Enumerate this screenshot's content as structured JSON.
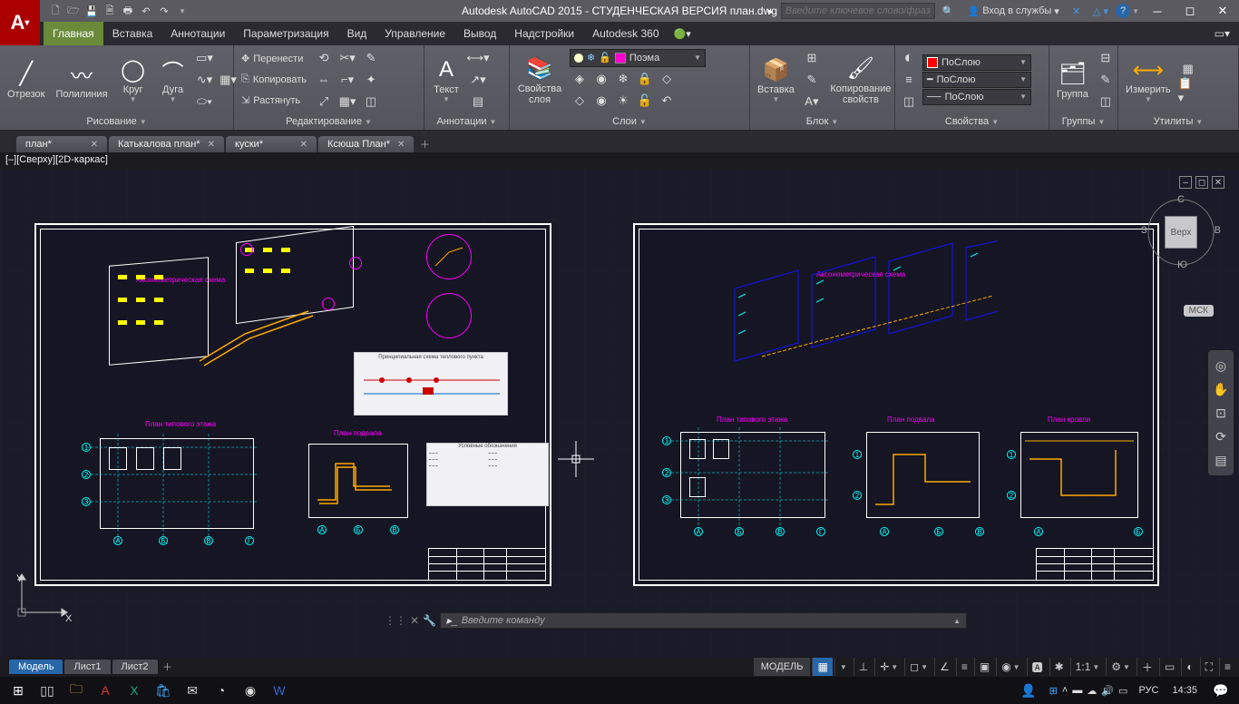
{
  "title": "Autodesk AutoCAD 2015 - СТУДЕНЧЕСКАЯ ВЕРСИЯ   план.dwg",
  "search_placeholder": "Введите ключевое слово/фразу",
  "sign_in": "Вход в службы",
  "ribbon_tabs": [
    "Главная",
    "Вставка",
    "Аннотации",
    "Параметризация",
    "Вид",
    "Управление",
    "Вывод",
    "Надстройки",
    "Autodesk 360"
  ],
  "panels": {
    "draw": {
      "label": "Рисование",
      "line": "Отрезок",
      "polyline": "Полилиния",
      "circle": "Круг",
      "arc": "Дуга"
    },
    "modify": {
      "label": "Редактирование",
      "move": "Перенести",
      "copy": "Копировать",
      "stretch": "Растянуть"
    },
    "annotation": {
      "label": "Аннотации",
      "text": "Текст"
    },
    "layers": {
      "label": "Слои",
      "props": "Свойства слоя",
      "current": "Поэма"
    },
    "block": {
      "label": "Блок",
      "insert": "Вставка",
      "copy_props": "Копирование свойств"
    },
    "properties": {
      "label": "Свойства",
      "bylayer": "ПоСлою",
      "byblock": "ПоСлою",
      "line3": "ПоСлою"
    },
    "groups": {
      "label": "Группы",
      "group": "Группа"
    },
    "utilities": {
      "label": "Утилиты",
      "measure": "Измерить"
    }
  },
  "file_tabs": [
    "план*",
    "Катькалова план*",
    "куски*",
    "Ксюша План*"
  ],
  "viewport_label": "[–][Сверху][2D-каркас]",
  "navcube": {
    "top": "Верх",
    "n": "С",
    "s": "Ю",
    "e": "В",
    "w": "З",
    "wcs": "МСК"
  },
  "command_placeholder": "Введите команду",
  "layout_tabs": [
    "Модель",
    "Лист1",
    "Лист2"
  ],
  "statusbar": {
    "model": "МОДЕЛЬ",
    "scale": "1:1"
  },
  "drawing_labels": {
    "axono": "Аксонометрическая схема",
    "plan1": "План типового этажа",
    "plan2": "План подвала",
    "plan3": "План кровли",
    "scheme": "Принципиальная схема теплового пункта",
    "legend": "Условные обозначения"
  },
  "taskbar": {
    "lang": "РУС",
    "time": "14:35"
  }
}
